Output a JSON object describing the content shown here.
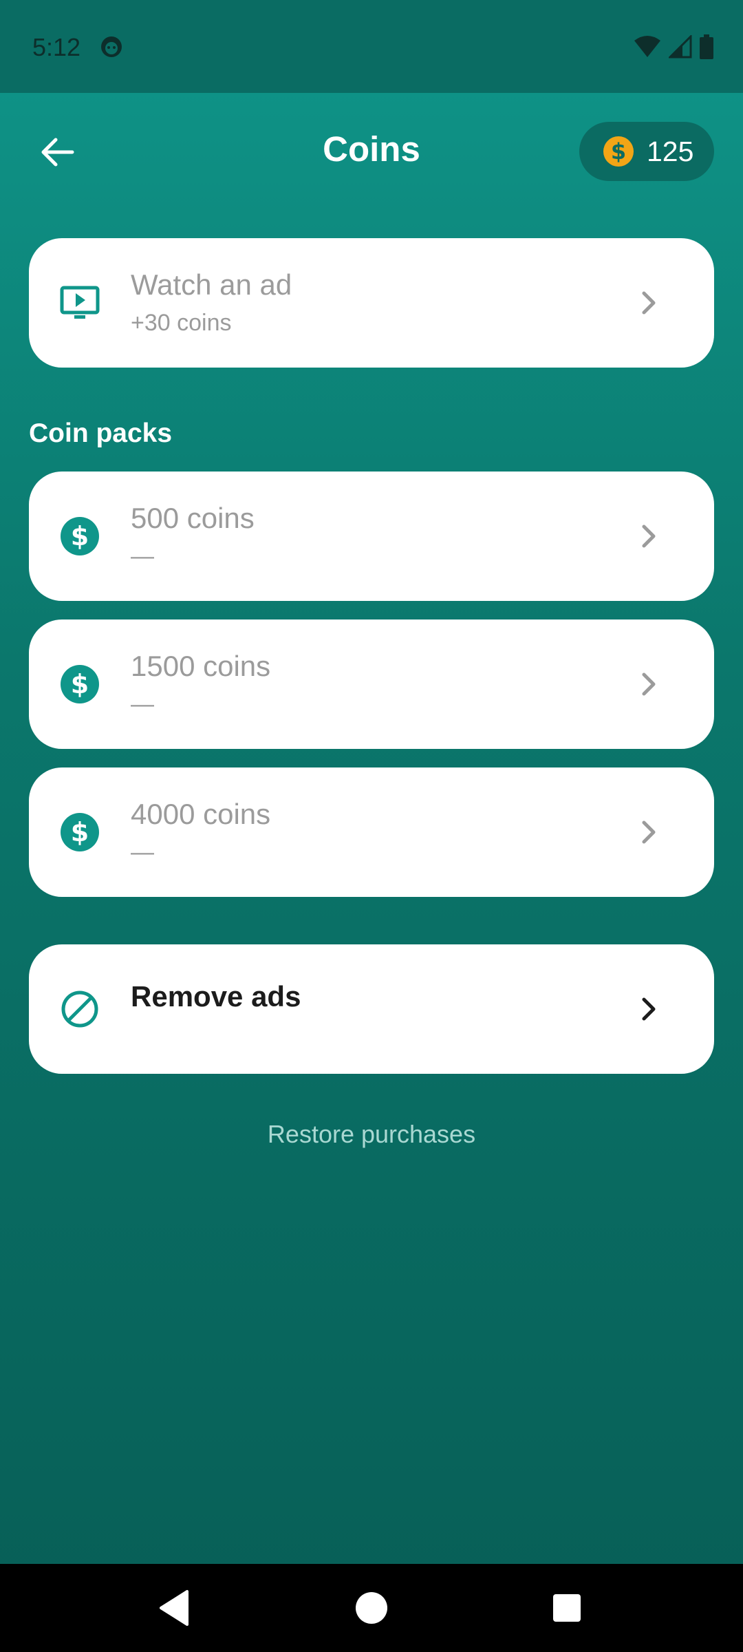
{
  "status_bar": {
    "time": "5:12"
  },
  "header": {
    "title": "Coins",
    "balance": "125"
  },
  "watch_ad": {
    "title": "Watch an ad",
    "subtitle": "+30 coins"
  },
  "section": {
    "coin_packs_label": "Coin packs"
  },
  "packs": [
    {
      "title": "500 coins",
      "price": "—"
    },
    {
      "title": "1500 coins",
      "price": "—"
    },
    {
      "title": "4000 coins",
      "price": "—"
    }
  ],
  "remove_ads": {
    "title": "Remove ads"
  },
  "restore": {
    "label": "Restore purchases"
  },
  "colors": {
    "accent": "#0f968a",
    "coin": "#f2a516",
    "card": "#ffffff",
    "disabled_text": "#9b9b9b"
  },
  "icons": {
    "back": "arrow-left-icon",
    "coin": "dollar-coin-icon",
    "ad": "tv-play-icon",
    "chevron": "chevron-right-icon",
    "remove_ads": "block-icon"
  }
}
